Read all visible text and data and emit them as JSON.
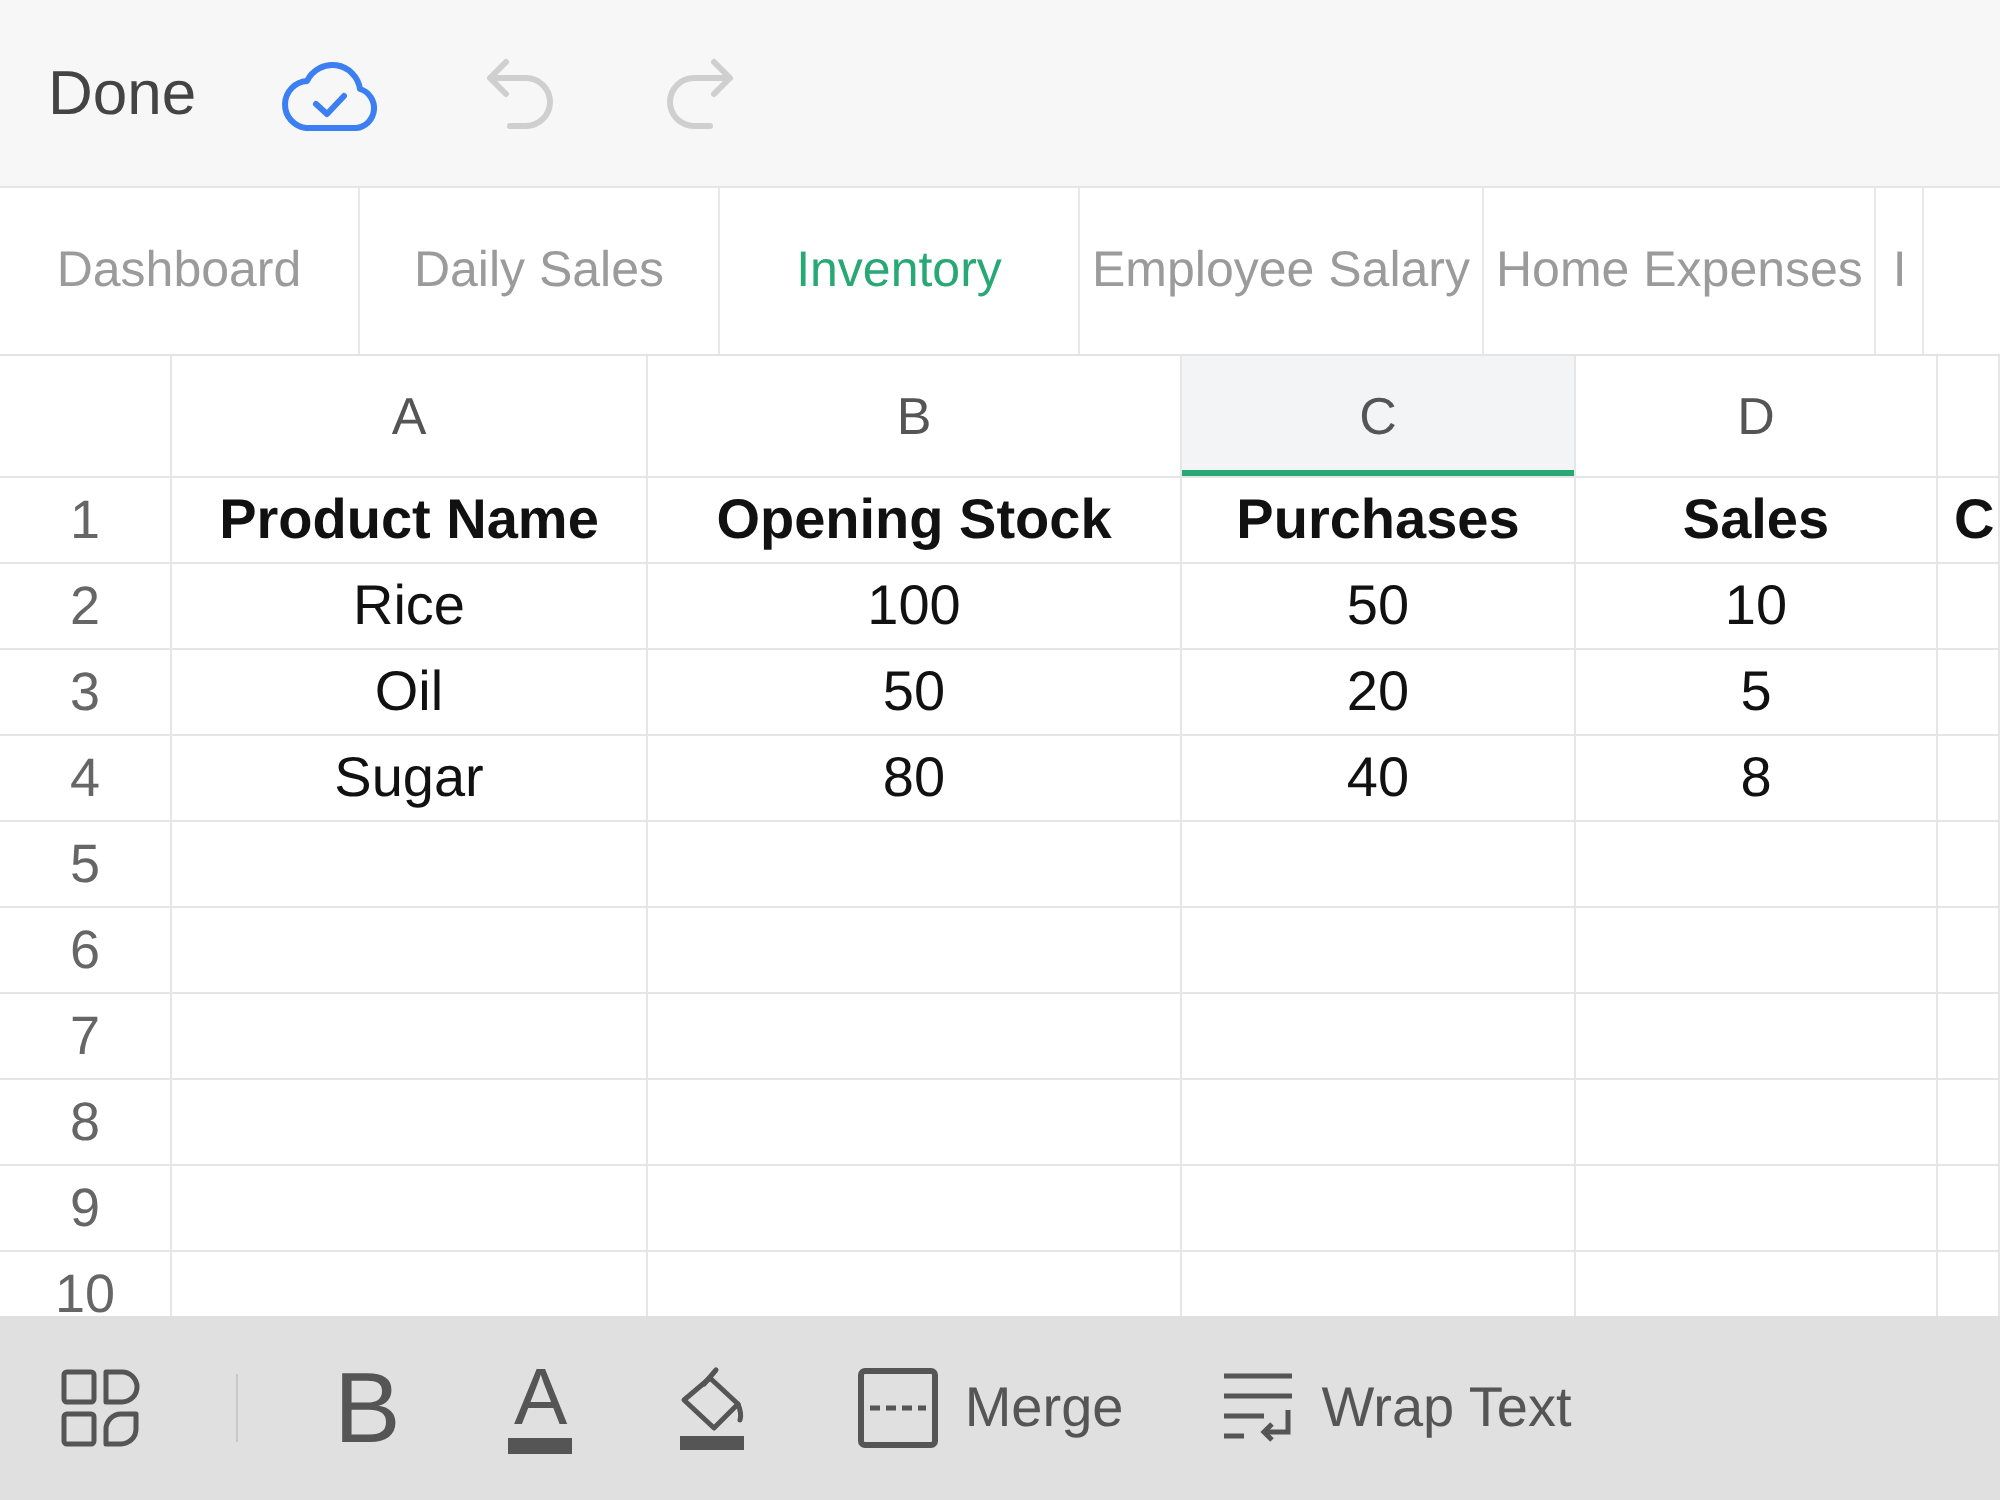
{
  "top_bar": {
    "done_label": "Done",
    "undo_disabled": true,
    "redo_disabled": true
  },
  "sheet_tabs": [
    {
      "label": "Dashboard",
      "selected": false
    },
    {
      "label": "Daily Sales",
      "selected": false
    },
    {
      "label": "Inventory",
      "selected": true
    },
    {
      "label": "Employee Salary",
      "selected": false
    },
    {
      "label": "Home Expenses",
      "selected": false
    },
    {
      "label": "I",
      "selected": false
    }
  ],
  "grid": {
    "columns": [
      {
        "letter": "A",
        "selected": false
      },
      {
        "letter": "B",
        "selected": false
      },
      {
        "letter": "C",
        "selected": true
      },
      {
        "letter": "D",
        "selected": false
      },
      {
        "selected": false
      }
    ],
    "rows": [
      {
        "number": "1",
        "cells": [
          {
            "text": "Product Name",
            "bold": true
          },
          {
            "text": "Opening Stock",
            "bold": true
          },
          {
            "text": "Purchases",
            "bold": true
          },
          {
            "text": "Sales",
            "bold": true
          },
          {
            "text": "C",
            "bold": true
          }
        ]
      },
      {
        "number": "2",
        "cells": [
          {
            "text": "Rice",
            "bold": false
          },
          {
            "text": "100",
            "bold": false
          },
          {
            "text": "50",
            "bold": false
          },
          {
            "text": "10",
            "bold": false
          }
        ]
      },
      {
        "number": "3",
        "cells": [
          {
            "text": "Oil",
            "bold": false
          },
          {
            "text": "50",
            "bold": false
          },
          {
            "text": "20",
            "bold": false
          },
          {
            "text": "5",
            "bold": false
          }
        ]
      },
      {
        "number": "4",
        "cells": [
          {
            "text": "Sugar",
            "bold": false
          },
          {
            "text": "80",
            "bold": false
          },
          {
            "text": "40",
            "bold": false
          },
          {
            "text": "8",
            "bold": false
          }
        ]
      },
      {
        "number": "5"
      },
      {
        "number": "6"
      },
      {
        "number": "7"
      },
      {
        "number": "8"
      },
      {
        "number": "9"
      },
      {
        "number": "10"
      }
    ]
  },
  "toolbar": {
    "bold_glyph": "B",
    "font_color_glyph": "A",
    "merge_label": "Merge",
    "wrap_label": "Wrap Text"
  }
}
